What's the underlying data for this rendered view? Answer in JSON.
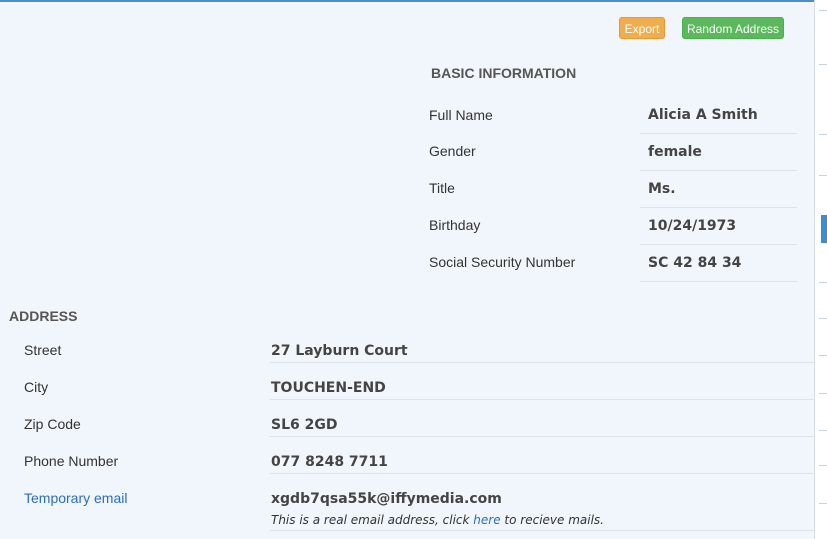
{
  "toolbar": {
    "export_label": "Export",
    "random_address_label": "Random Address"
  },
  "basic_information": {
    "title": "BASIC INFORMATION",
    "rows": [
      {
        "label": "Full Name",
        "value": "Alicia A Smith"
      },
      {
        "label": "Gender",
        "value": "female"
      },
      {
        "label": "Title",
        "value": "Ms."
      },
      {
        "label": "Birthday",
        "value": "10/24/1973"
      },
      {
        "label": "Social Security Number",
        "value": "SC 42 84 34"
      }
    ]
  },
  "address": {
    "title": "ADDRESS",
    "rows": [
      {
        "label": "Street",
        "value": "27  Layburn Court"
      },
      {
        "label": "City",
        "value": "TOUCHEN-END"
      },
      {
        "label": "Zip Code",
        "value": "SL6 2GD"
      },
      {
        "label": "Phone Number",
        "value": "077 8248 7711"
      }
    ],
    "email": {
      "label": "Temporary email",
      "value": "xgdb7qsa55k@iffymedia.com",
      "note_prefix": "This is a real email address, click ",
      "note_link": "here",
      "note_suffix": " to recieve mails."
    }
  },
  "colors": {
    "export_button": "#f0ad4e",
    "random_button": "#5cb85c",
    "link": "#2a6ebb",
    "background": "#f0f6fb"
  }
}
